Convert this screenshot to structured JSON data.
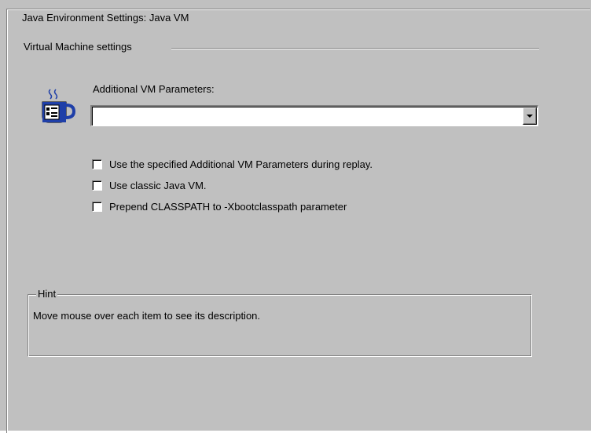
{
  "window": {
    "group_title": "Java Environment Settings: Java VM"
  },
  "vm_settings": {
    "section_label": "Virtual Machine settings",
    "icon": "java-coffee-cup-icon",
    "params_label": "Additional VM Parameters:",
    "params_value": ""
  },
  "options": [
    {
      "label": "Use the specified Additional VM Parameters during replay.",
      "checked": false
    },
    {
      "label": "Use classic Java VM.",
      "checked": false
    },
    {
      "label": "Prepend CLASSPATH to -Xbootclasspath parameter",
      "checked": false
    }
  ],
  "hint": {
    "title": "Hint",
    "text": "Move mouse over each item to see its description."
  },
  "colors": {
    "face": "#c0c0c0",
    "shadow": "#808080",
    "highlight": "#ffffff",
    "icon_blue": "#1f3fa8"
  }
}
